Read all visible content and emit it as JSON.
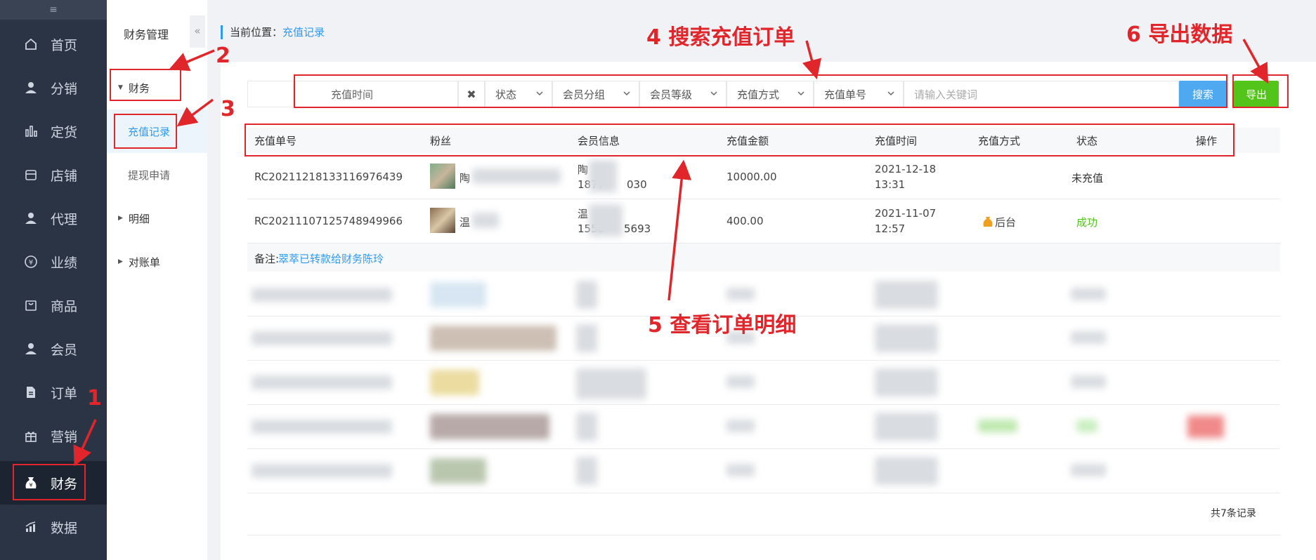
{
  "sidebar": {
    "collapse_icon": "menu-collapse-icon",
    "items": [
      {
        "label": "首页",
        "icon": "home-icon"
      },
      {
        "label": "分销",
        "icon": "user-icon"
      },
      {
        "label": "定货",
        "icon": "bar-chart-icon"
      },
      {
        "label": "店铺",
        "icon": "store-icon"
      },
      {
        "label": "代理",
        "icon": "user-icon"
      },
      {
        "label": "业绩",
        "icon": "yen-circle-icon"
      },
      {
        "label": "商品",
        "icon": "bag-icon"
      },
      {
        "label": "会员",
        "icon": "user-icon"
      },
      {
        "label": "订单",
        "icon": "document-icon"
      },
      {
        "label": "营销",
        "icon": "gift-icon"
      },
      {
        "label": "财务",
        "icon": "money-bag-icon",
        "active": true
      },
      {
        "label": "数据",
        "icon": "stats-icon"
      }
    ]
  },
  "subnav": {
    "title": "财务管理",
    "fold_icon": "double-chevron-left-icon",
    "items": [
      {
        "label": "财务",
        "type": "group"
      },
      {
        "label": "充值记录",
        "type": "leaf",
        "active": true
      },
      {
        "label": "提现申请",
        "type": "leaf"
      },
      {
        "label": "明细",
        "type": "group"
      },
      {
        "label": "对账单",
        "type": "group"
      }
    ]
  },
  "breadcrumb": {
    "prefix": "当前位置：",
    "current": "充值记录"
  },
  "filters": {
    "date_placeholder": "充值时间",
    "clear_icon": "close-icon",
    "status": "状态",
    "member_group": "会员分组",
    "member_level": "会员等级",
    "pay_method": "充值方式",
    "order_no": "充值单号",
    "keyword_placeholder": "请输入关键词",
    "search_label": "搜索",
    "export_label": "导出"
  },
  "table": {
    "headers": [
      "充值单号",
      "粉丝",
      "会员信息",
      "充值金额",
      "充值时间",
      "充值方式",
      "状态",
      "操作"
    ],
    "rows": [
      {
        "order_no": "RC20211218133116976439",
        "fan": "陶",
        "member_name": "陶",
        "member_phone_a": "1877",
        "member_phone_b": "030",
        "amount": "10000.00",
        "date": "2021-12-18",
        "time": "13:31",
        "method": "",
        "status": "未充值"
      },
      {
        "order_no": "RC20211107125748949966",
        "fan": "温",
        "member_name": "温",
        "member_phone_a": "1550",
        "member_phone_b": "5693",
        "amount": "400.00",
        "date": "2021-11-07",
        "time": "12:57",
        "method": "后台",
        "status": "成功"
      }
    ],
    "remark_label": "备注:",
    "remark_text": "翠萃已转款给财务陈玲",
    "total": "共7条记录"
  },
  "annotations": {
    "a1": "1",
    "a2": "2",
    "a3": "3",
    "a4": "4 搜索充值订单",
    "a5": "5 查看订单明细",
    "a6": "6 导出数据"
  },
  "colors": {
    "accent": "#2d9af0",
    "sidebar": "#2b3444",
    "export": "#52c41a",
    "annotation": "#e0262b",
    "success": "#52c41a"
  }
}
